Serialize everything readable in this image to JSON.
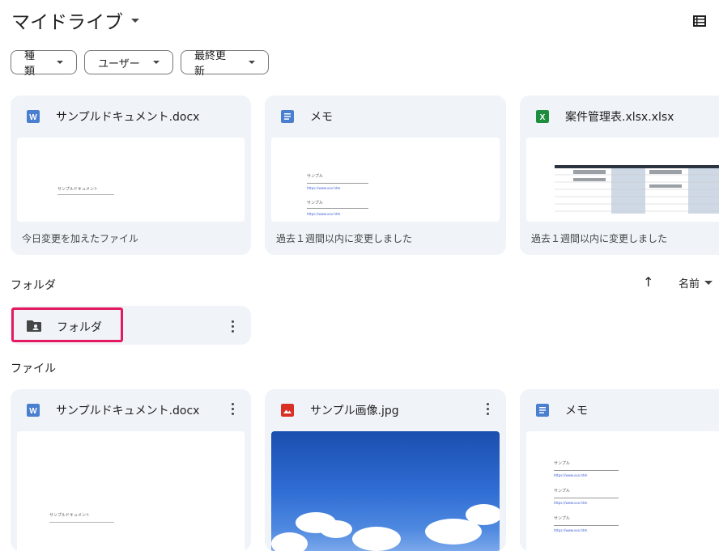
{
  "header": {
    "title": "マイドライブ"
  },
  "filters": [
    {
      "label": "種類"
    },
    {
      "label": "ユーザー"
    },
    {
      "label": "最終更新"
    }
  ],
  "suggested": [
    {
      "name": "サンプルドキュメント.docx",
      "icon": "word-icon",
      "footer": "今日変更を加えたファイル",
      "thumb_title": "サンプルドキュメント"
    },
    {
      "name": "メモ",
      "icon": "docs-icon",
      "footer": "過去１週間以内に変更しました",
      "thumb_lines": [
        "サンプル",
        "https://www.xxx.htm",
        "サンプル",
        "https://www.xxx.htm"
      ]
    },
    {
      "name": "案件管理表.xlsx.xlsx",
      "icon": "excel-icon",
      "footer": "過去１週間以内に変更しました"
    }
  ],
  "sections": {
    "folders": "フォルダ",
    "files": "ファイル"
  },
  "sort": {
    "label": "名前"
  },
  "folders": [
    {
      "name": "フォルダ",
      "icon": "shared-folder-icon"
    }
  ],
  "files": [
    {
      "name": "サンプルドキュメント.docx",
      "icon": "word-icon",
      "thumb_title": "サンプルドキュメント"
    },
    {
      "name": "サンプル画像.jpg",
      "icon": "image-icon"
    },
    {
      "name": "メモ",
      "icon": "docs-icon",
      "thumb_lines": [
        "サンプル",
        "https://www.xxx.htm",
        "サンプル",
        "https://www.xxx.htm",
        "サンプル",
        "https://www.xxx.htm"
      ]
    }
  ],
  "colors": {
    "word": "#4a7fd0",
    "docs": "#4a7fd0",
    "excel": "#1e8e3e",
    "image": "#d93025",
    "highlight": "#e5195f",
    "card_bg": "#f0f4f9"
  }
}
